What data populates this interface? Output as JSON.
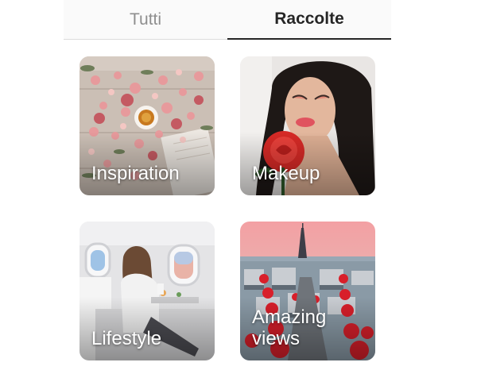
{
  "tabs": {
    "all_label": "Tutti",
    "collections_label": "Raccolte",
    "active": "Raccolte"
  },
  "collections": [
    {
      "title": "Inspiration",
      "lines": [
        "Inspiration"
      ]
    },
    {
      "title": "Makeup",
      "lines": [
        "Makeup"
      ]
    },
    {
      "title": "Lifestyle",
      "lines": [
        "Lifestyle"
      ]
    },
    {
      "title": "Amazing views",
      "lines": [
        "Amazing",
        "views"
      ]
    }
  ],
  "colors": {
    "active_tab_text": "#262626",
    "inactive_tab_text": "#8e8e8e",
    "tab_indicator": "#262626",
    "label_text": "#ffffff"
  }
}
